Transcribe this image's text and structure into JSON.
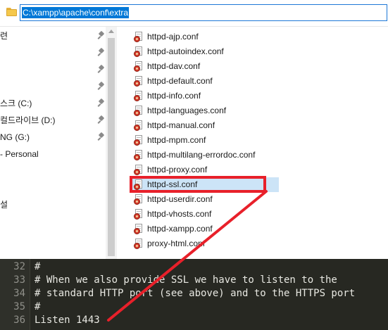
{
  "address_bar": {
    "path": "C:\\xampp\\apache\\conf\\extra"
  },
  "nav_pane": {
    "items": [
      {
        "label": "련",
        "pinned": true
      },
      {
        "label": "",
        "pinned": true
      },
      {
        "label": "",
        "pinned": true
      },
      {
        "label": "",
        "pinned": true
      },
      {
        "label": "스크 (C:)",
        "pinned": true
      },
      {
        "label": "컬드라이브 (D:)",
        "pinned": true
      },
      {
        "label": "NG (G:)",
        "pinned": true
      },
      {
        "label": "- Personal",
        "pinned": false
      },
      {
        "label": "",
        "pinned": false
      },
      {
        "label": "",
        "pinned": false
      },
      {
        "label": "설",
        "pinned": false
      }
    ]
  },
  "file_list": {
    "files": [
      {
        "name": "httpd-ajp.conf",
        "selected": false
      },
      {
        "name": "httpd-autoindex.conf",
        "selected": false
      },
      {
        "name": "httpd-dav.conf",
        "selected": false
      },
      {
        "name": "httpd-default.conf",
        "selected": false
      },
      {
        "name": "httpd-info.conf",
        "selected": false
      },
      {
        "name": "httpd-languages.conf",
        "selected": false
      },
      {
        "name": "httpd-manual.conf",
        "selected": false
      },
      {
        "name": "httpd-mpm.conf",
        "selected": false
      },
      {
        "name": "httpd-multilang-errordoc.conf",
        "selected": false
      },
      {
        "name": "httpd-proxy.conf",
        "selected": false
      },
      {
        "name": "httpd-ssl.conf",
        "selected": true
      },
      {
        "name": "httpd-userdir.conf",
        "selected": false
      },
      {
        "name": "httpd-vhosts.conf",
        "selected": false
      },
      {
        "name": "httpd-xampp.conf",
        "selected": false
      },
      {
        "name": "proxy-html.conf",
        "selected": false
      }
    ]
  },
  "editor": {
    "lines": [
      {
        "number": "32",
        "code": "#"
      },
      {
        "number": "33",
        "code": "# When we also provide SSL we have to listen to the"
      },
      {
        "number": "34",
        "code": "# standard HTTP port (see above) and to the HTTPS port"
      },
      {
        "number": "35",
        "code": "#"
      },
      {
        "number": "36",
        "code": "Listen 1443"
      }
    ]
  },
  "annotation": {
    "color": "#e8202a",
    "target_file": "httpd-ssl.conf"
  },
  "colors": {
    "selection": "#0078d7",
    "editor_bg": "#272822"
  }
}
